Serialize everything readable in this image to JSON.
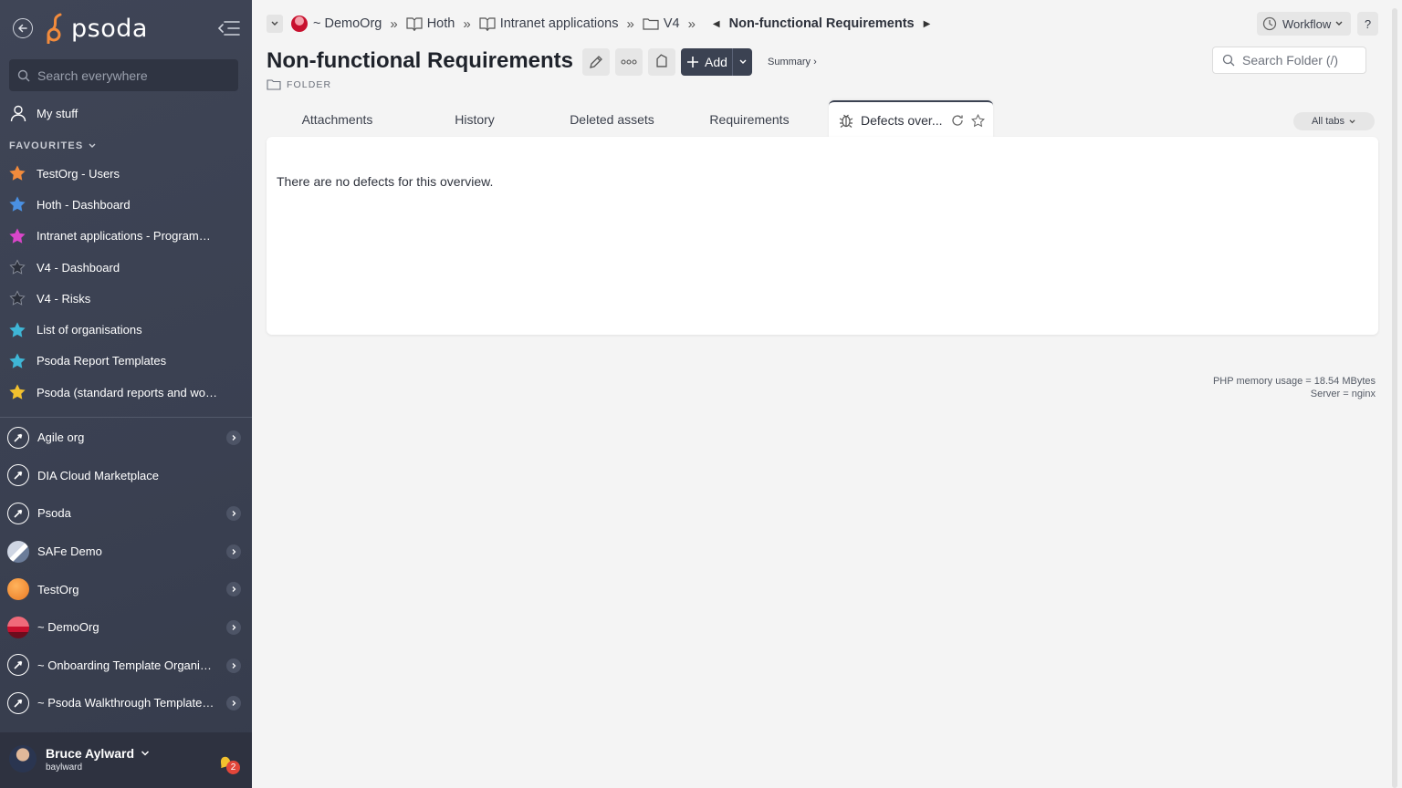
{
  "sidebar": {
    "logo_text": "psoda",
    "search_placeholder": "Search everywhere",
    "my_stuff": "My stuff",
    "favourites_label": "FAVOURITES",
    "favourites": [
      {
        "label": "TestOrg - Users",
        "color": "#f28b3c"
      },
      {
        "label": "Hoth - Dashboard",
        "color": "#4a90e2"
      },
      {
        "label": "Intranet applications - Programme...",
        "color": "#d946c9"
      },
      {
        "label": "V4 - Dashboard",
        "color": "#2b2f3a"
      },
      {
        "label": "V4 - Risks",
        "color": "#2b2f3a"
      },
      {
        "label": "List of organisations",
        "color": "#3fb6d6"
      },
      {
        "label": "Psoda Report Templates",
        "color": "#3fb6d6"
      },
      {
        "label": "Psoda (standard reports and work...",
        "color": "#f2c12e"
      }
    ],
    "organisations": [
      {
        "label": "Agile org",
        "icon": "rocket-icon",
        "has_children": true
      },
      {
        "label": "DIA Cloud Marketplace",
        "icon": "rocket-icon",
        "has_children": false
      },
      {
        "label": "Psoda",
        "icon": "rocket-icon",
        "has_children": true
      },
      {
        "label": "SAFe Demo",
        "icon": "mountain-icon",
        "has_children": true
      },
      {
        "label": "TestOrg",
        "icon": "orange-circle-icon",
        "has_children": true
      },
      {
        "label": "~ DemoOrg",
        "icon": "sunset-icon",
        "has_children": true
      },
      {
        "label": "~ Onboarding Template Organisa...",
        "icon": "rocket-icon",
        "has_children": true
      },
      {
        "label": "~ Psoda Walkthrough Template P...",
        "icon": "rocket-icon",
        "has_children": true
      }
    ],
    "user": {
      "name": "Bruce Aylward",
      "handle": "baylward",
      "notifications": "2"
    }
  },
  "breadcrumbs": [
    {
      "label": "~ DemoOrg",
      "icon": "org-logo-icon"
    },
    {
      "label": "Hoth",
      "icon": "book-icon"
    },
    {
      "label": "Intranet applications",
      "icon": "book-icon"
    },
    {
      "label": "V4",
      "icon": "folder-icon"
    },
    {
      "label": "Non-functional Requirements",
      "current": true
    }
  ],
  "header": {
    "title": "Non-functional Requirements",
    "type_label": "FOLDER",
    "add_label": "Add",
    "summary_label": "Summary ›",
    "workflow_label": "Workflow",
    "help_label": "?",
    "search_placeholder": "Search Folder (/)"
  },
  "tabs": [
    {
      "label": "Attachments"
    },
    {
      "label": "History"
    },
    {
      "label": "Deleted assets"
    },
    {
      "label": "Requirements"
    },
    {
      "label": "Defects over...",
      "active": true
    }
  ],
  "all_tabs_label": "All tabs",
  "panel": {
    "message": "There are no defects for this overview."
  },
  "footer": {
    "memory": "PHP memory usage = 18.54 MBytes",
    "server": "Server = nginx"
  },
  "colors": {
    "sidebar": "#3d4354",
    "accent": "#3b4252",
    "logo_orange": "#f28b3c"
  }
}
